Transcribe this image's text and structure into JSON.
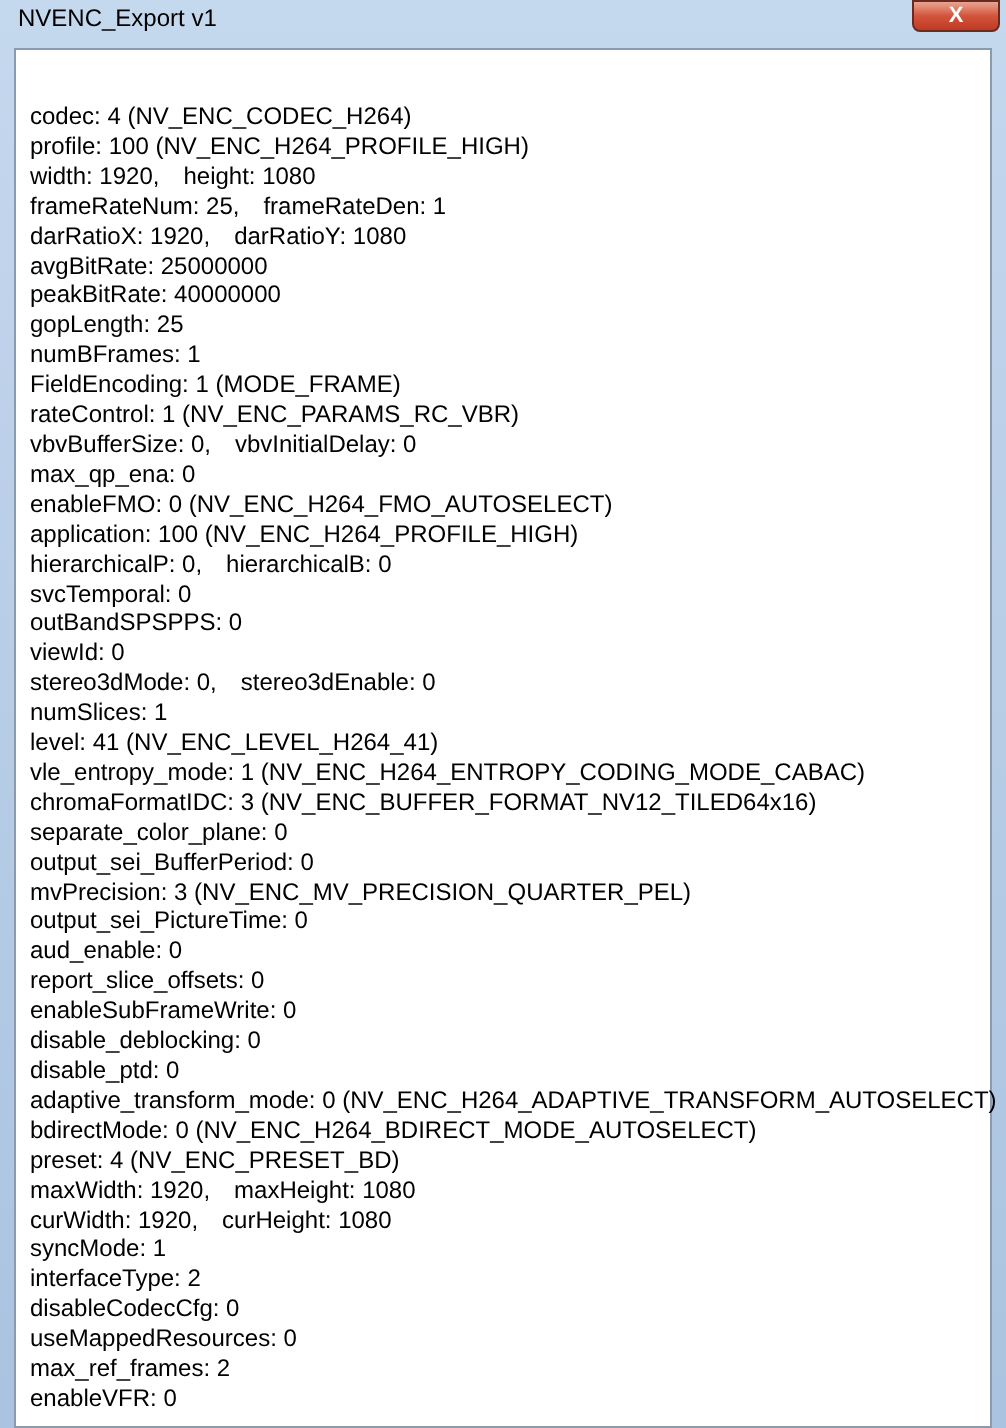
{
  "window": {
    "title": "NVENC_Export v1",
    "close_button": "X"
  },
  "lines": [
    {
      "parts": [
        "codec: 4 (NV_ENC_CODEC_H264)"
      ]
    },
    {
      "parts": [
        "profile: 100 (NV_ENC_H264_PROFILE_HIGH)"
      ]
    },
    {
      "parts": [
        "width: 1920,",
        "height: 1080"
      ]
    },
    {
      "parts": [
        "frameRateNum: 25,",
        "frameRateDen: 1"
      ]
    },
    {
      "parts": [
        "darRatioX: 1920,",
        "darRatioY: 1080"
      ]
    },
    {
      "parts": [
        "avgBitRate: 25000000"
      ]
    },
    {
      "parts": [
        "peakBitRate: 40000000"
      ]
    },
    {
      "parts": [
        "gopLength: 25"
      ]
    },
    {
      "parts": [
        "numBFrames: 1"
      ]
    },
    {
      "parts": [
        "FieldEncoding: 1 (MODE_FRAME)"
      ]
    },
    {
      "parts": [
        "rateControl: 1 (NV_ENC_PARAMS_RC_VBR)"
      ]
    },
    {
      "parts": [
        "vbvBufferSize: 0,",
        "vbvInitialDelay: 0"
      ]
    },
    {
      "parts": [
        "max_qp_ena: 0"
      ]
    },
    {
      "parts": [
        "enableFMO: 0 (NV_ENC_H264_FMO_AUTOSELECT)"
      ]
    },
    {
      "parts": [
        "application: 100 (NV_ENC_H264_PROFILE_HIGH)"
      ]
    },
    {
      "parts": [
        "hierarchicalP: 0,",
        "hierarchicalB: 0"
      ]
    },
    {
      "parts": [
        "svcTemporal: 0"
      ]
    },
    {
      "parts": [
        "outBandSPSPPS: 0"
      ]
    },
    {
      "parts": [
        "viewId: 0"
      ]
    },
    {
      "parts": [
        "stereo3dMode: 0,",
        "stereo3dEnable: 0"
      ]
    },
    {
      "parts": [
        "numSlices: 1"
      ]
    },
    {
      "parts": [
        "level: 41 (NV_ENC_LEVEL_H264_41)"
      ]
    },
    {
      "parts": [
        "vle_entropy_mode: 1 (NV_ENC_H264_ENTROPY_CODING_MODE_CABAC)"
      ]
    },
    {
      "parts": [
        "chromaFormatIDC: 3 (NV_ENC_BUFFER_FORMAT_NV12_TILED64x16)"
      ]
    },
    {
      "parts": [
        "separate_color_plane: 0"
      ]
    },
    {
      "parts": [
        "output_sei_BufferPeriod: 0"
      ]
    },
    {
      "parts": [
        "mvPrecision: 3 (NV_ENC_MV_PRECISION_QUARTER_PEL)"
      ]
    },
    {
      "parts": [
        "output_sei_PictureTime: 0"
      ]
    },
    {
      "parts": [
        "aud_enable: 0"
      ]
    },
    {
      "parts": [
        "report_slice_offsets: 0"
      ]
    },
    {
      "parts": [
        "enableSubFrameWrite: 0"
      ]
    },
    {
      "parts": [
        "disable_deblocking: 0"
      ]
    },
    {
      "parts": [
        "disable_ptd: 0"
      ]
    },
    {
      "parts": [
        "adaptive_transform_mode: 0 (NV_ENC_H264_ADAPTIVE_TRANSFORM_AUTOSELECT)"
      ]
    },
    {
      "parts": [
        "bdirectMode: 0 (NV_ENC_H264_BDIRECT_MODE_AUTOSELECT)"
      ]
    },
    {
      "parts": [
        "preset: 4 (NV_ENC_PRESET_BD)"
      ]
    },
    {
      "parts": [
        "maxWidth: 1920,",
        "maxHeight: 1080"
      ]
    },
    {
      "parts": [
        "curWidth: 1920,",
        "curHeight: 1080"
      ]
    },
    {
      "parts": [
        "syncMode: 1"
      ]
    },
    {
      "parts": [
        "interfaceType: 2"
      ]
    },
    {
      "parts": [
        "disableCodecCfg: 0"
      ]
    },
    {
      "parts": [
        "useMappedResources: 0"
      ]
    },
    {
      "parts": [
        "max_ref_frames: 2"
      ]
    },
    {
      "parts": [
        "enableVFR: 0"
      ]
    }
  ]
}
